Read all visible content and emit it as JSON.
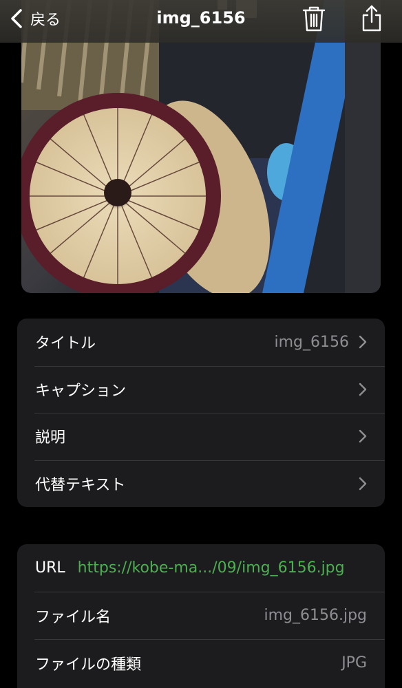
{
  "navbar": {
    "back_label": "戻る",
    "title": "img_6156"
  },
  "details": [
    {
      "label": "タイトル",
      "value": "img_6156"
    },
    {
      "label": "キャプション",
      "value": ""
    },
    {
      "label": "説明",
      "value": ""
    },
    {
      "label": "代替テキスト",
      "value": ""
    }
  ],
  "file_info": {
    "url_label": "URL",
    "url_value": "https://kobe-ma.../09/img_6156.jpg",
    "filename_label": "ファイル名",
    "filename_value": "img_6156.jpg",
    "filetype_label": "ファイルの種類",
    "filetype_value": "JPG"
  },
  "colors": {
    "link": "#4caf50",
    "secondary_text": "#8e8e93",
    "group_bg": "#1c1c1e"
  },
  "icons": [
    "chevron-left-icon",
    "trash-icon",
    "share-icon",
    "chevron-right-icon"
  ]
}
